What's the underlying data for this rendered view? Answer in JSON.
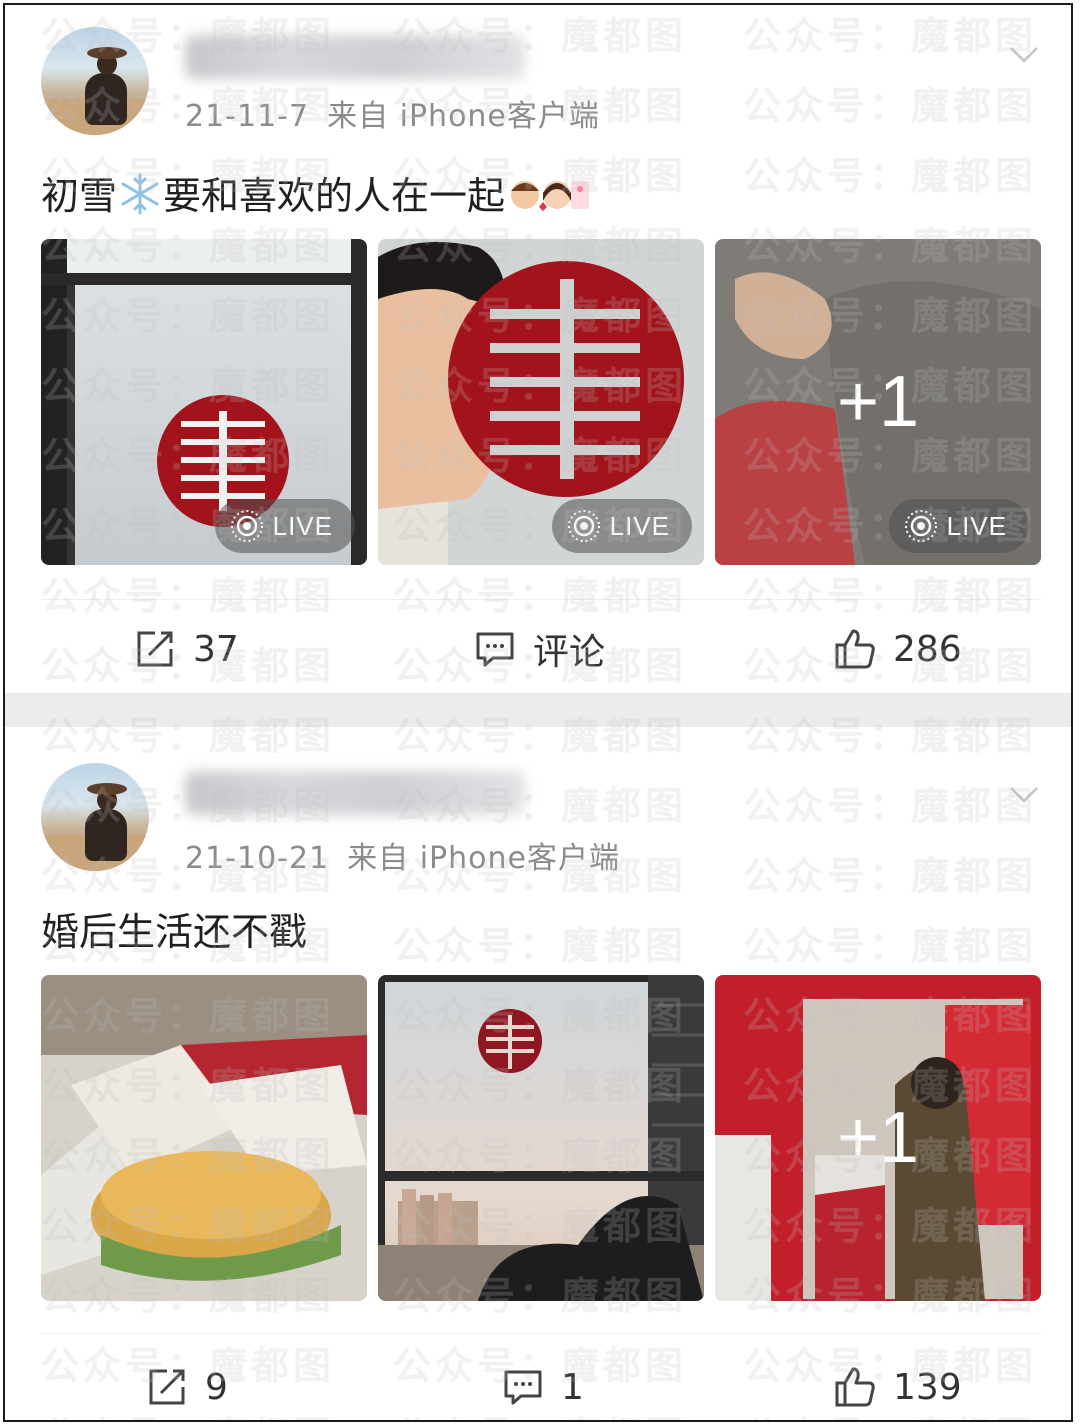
{
  "watermark_text": "公众号：魔都图",
  "posts": [
    {
      "date": "21-11-7",
      "source": "来自 iPhone客户端",
      "text": "初雪",
      "text_rest": "要和喜欢的人在一起",
      "photos": [
        {
          "badge": "LIVE"
        },
        {
          "badge": "LIVE"
        },
        {
          "badge": "LIVE",
          "overlay": "+1"
        }
      ],
      "actions": {
        "repost": "37",
        "comment": "评论",
        "like": "286"
      }
    },
    {
      "date": "21-10-21",
      "source": "来自 iPhone客户端",
      "text": "婚后生活还不戳",
      "photos": [
        {},
        {},
        {
          "overlay": "+1"
        }
      ],
      "actions": {
        "repost": "9",
        "comment": "1",
        "like": "139"
      }
    }
  ],
  "icons": {
    "repost": "repost-icon",
    "comment": "comment-icon",
    "like": "thumbs-up-icon",
    "more": "chevron-down-icon",
    "live": "live-photo-icon"
  },
  "colors": {
    "text": "#1f1f1f",
    "meta": "#8b8b8b",
    "separator": "#ececec",
    "double_happiness_red": "#a3131c"
  }
}
